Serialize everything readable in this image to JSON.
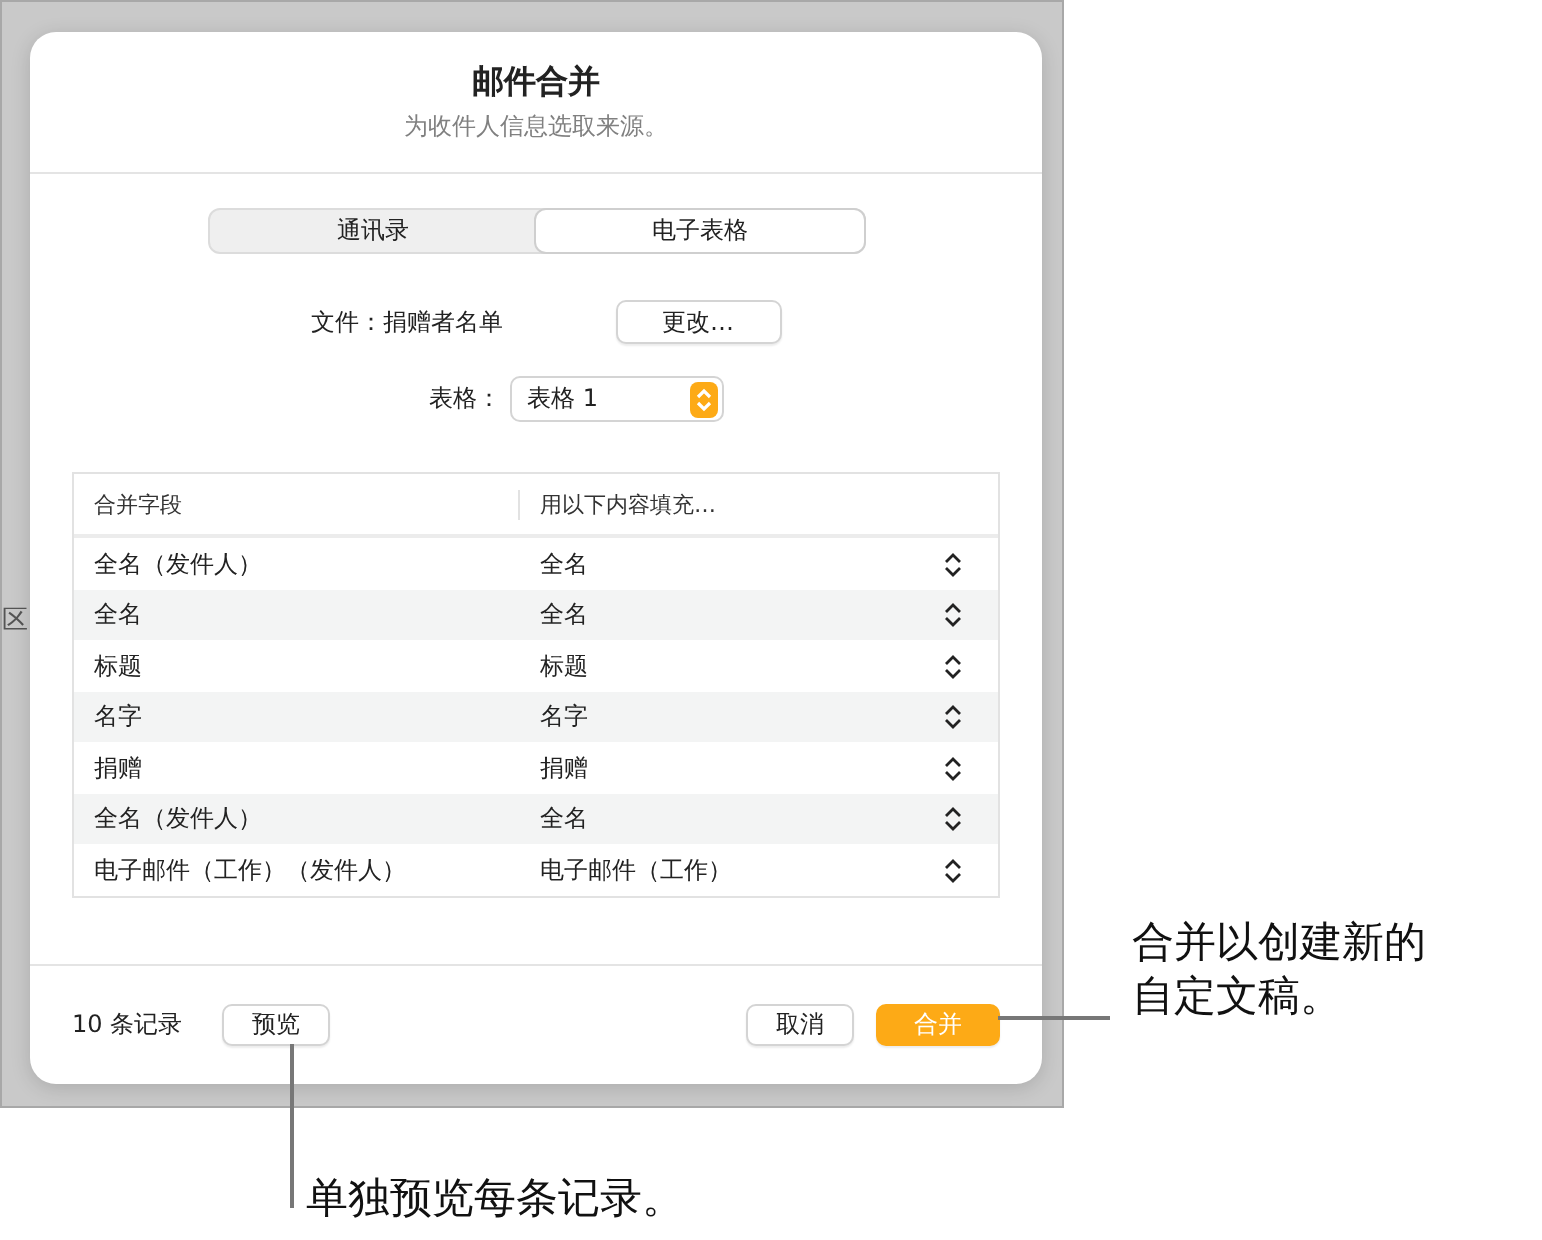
{
  "background": {
    "side_label": "区"
  },
  "dialog": {
    "title": "邮件合并",
    "subtitle": "为收件人信息选取来源。",
    "source_tabs": [
      {
        "label": "通讯录",
        "selected": false
      },
      {
        "label": "电子表格",
        "selected": true
      }
    ],
    "file": {
      "label": "文件：捐赠者名单",
      "button": "更改…"
    },
    "table_picker": {
      "label": "表格：",
      "value": "表格 1"
    },
    "fields_table": {
      "columns": [
        "合并字段",
        "用以下内容填充…"
      ],
      "rows": [
        {
          "field": "全名（发件人）",
          "fill": "全名"
        },
        {
          "field": "全名",
          "fill": "全名"
        },
        {
          "field": "标题",
          "fill": "标题"
        },
        {
          "field": "名字",
          "fill": "名字"
        },
        {
          "field": "捐赠",
          "fill": "捐赠"
        },
        {
          "field": "全名（发件人）",
          "fill": "全名"
        },
        {
          "field": "电子邮件（工作）（发件人）",
          "fill": "电子邮件（工作）"
        }
      ]
    },
    "footer": {
      "record_count": "10 条记录",
      "preview_button": "预览",
      "cancel_button": "取消",
      "merge_button": "合并"
    }
  },
  "callouts": [
    {
      "kind": "merge",
      "text": "合并以创建新的自定文稿。"
    },
    {
      "kind": "preview",
      "text": "单独预览每条记录。"
    }
  ]
}
